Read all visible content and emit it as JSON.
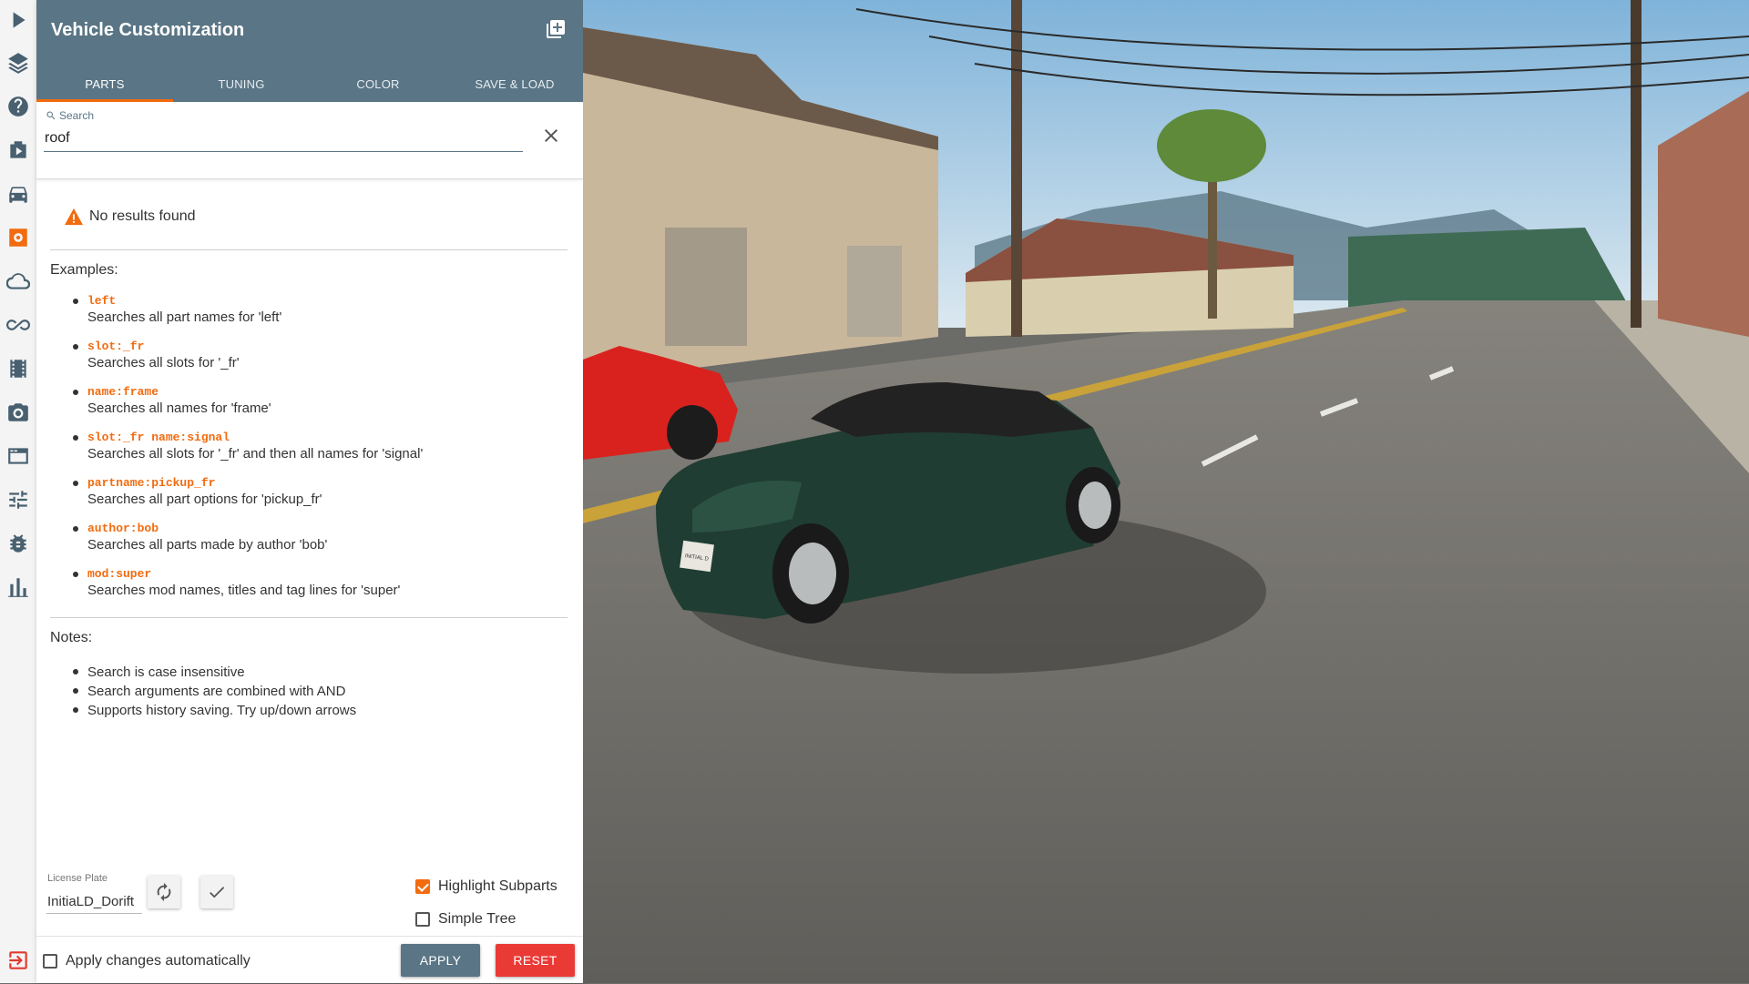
{
  "window": {
    "title": "Vehicle Customization"
  },
  "tabs": [
    {
      "label": "PARTS",
      "active": true
    },
    {
      "label": "TUNING",
      "active": false
    },
    {
      "label": "COLOR",
      "active": false
    },
    {
      "label": "SAVE & LOAD",
      "active": false
    }
  ],
  "search": {
    "label": "Search",
    "value": "roof"
  },
  "results": {
    "message": "No results found",
    "examples_label": "Examples:",
    "examples": [
      {
        "code": "left",
        "desc": "Searches all part names for 'left'"
      },
      {
        "code": "slot:_fr",
        "desc": "Searches all slots for '_fr'"
      },
      {
        "code": "name:frame",
        "desc": "Searches all names for 'frame'"
      },
      {
        "code": "slot:_fr name:signal",
        "desc": "Searches all slots for '_fr' and then all names for 'signal'"
      },
      {
        "code": "partname:pickup_fr",
        "desc": "Searches all part options for 'pickup_fr'"
      },
      {
        "code": "author:bob",
        "desc": "Searches all parts made by author 'bob'"
      },
      {
        "code": "mod:super",
        "desc": "Searches mod names, titles and tag lines for 'super'"
      }
    ],
    "notes_label": "Notes:",
    "notes": [
      "Search is case insensitive",
      "Search arguments are combined with AND",
      "Supports history saving. Try up/down arrows"
    ]
  },
  "license_plate": {
    "label": "License Plate",
    "value": "InitiaLD_Dorift"
  },
  "options": {
    "highlight_subparts": {
      "label": "Highlight Subparts",
      "checked": true
    },
    "simple_tree": {
      "label": "Simple Tree",
      "checked": false
    },
    "apply_auto": {
      "label": "Apply changes automatically",
      "checked": false
    }
  },
  "buttons": {
    "apply": "APPLY",
    "reset": "RESET"
  },
  "scene": {
    "car_plate_text": "INITIAL D"
  },
  "colors": {
    "accent": "#f26b0f",
    "header": "#5a7585",
    "reset": "#ea3a36",
    "car_body": "#1f3d33"
  },
  "sidebar_icons": [
    "play-icon",
    "layers-icon",
    "help-icon",
    "video-icon",
    "car-icon",
    "parts-icon",
    "cloud-icon",
    "infinity-icon",
    "film-icon",
    "camera-icon",
    "window-icon",
    "sliders-icon",
    "bug-icon",
    "stats-icon",
    "exit-icon"
  ]
}
